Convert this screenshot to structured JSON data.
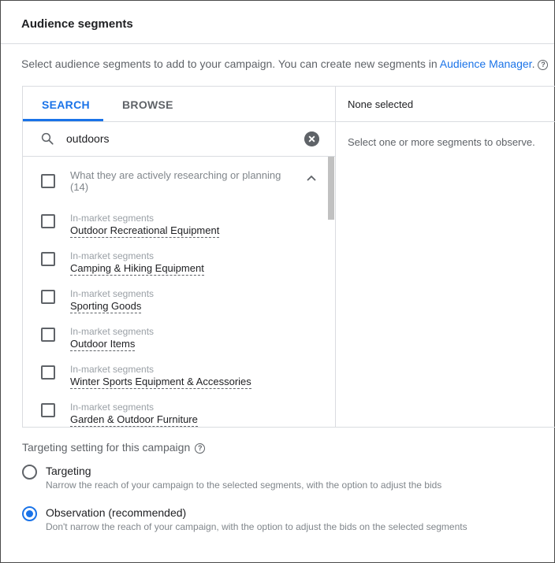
{
  "card": {
    "title": "Audience segments"
  },
  "description": {
    "text": "Select audience segments to add to your campaign. You can create new segments in ",
    "link": "Audience Manager",
    "suffix": "."
  },
  "tabs": [
    {
      "label": "SEARCH",
      "active": true
    },
    {
      "label": "BROWSE",
      "active": false
    }
  ],
  "search": {
    "value": "outdoors",
    "icon": "search-icon",
    "clear_icon": "clear-icon"
  },
  "group": {
    "label": "What they are actively researching or planning",
    "count": "(14)",
    "expanded": true
  },
  "items": [
    {
      "category": "In-market segments",
      "name": "Outdoor Recreational Equipment",
      "checked": false
    },
    {
      "category": "In-market segments",
      "name": "Camping & Hiking Equipment",
      "checked": false
    },
    {
      "category": "In-market segments",
      "name": "Sporting Goods",
      "checked": false
    },
    {
      "category": "In-market segments",
      "name": "Outdoor Items",
      "checked": false
    },
    {
      "category": "In-market segments",
      "name": "Winter Sports Equipment & Accessories",
      "checked": false
    },
    {
      "category": "In-market segments",
      "name": "Garden & Outdoor Furniture",
      "checked": false
    }
  ],
  "selected_panel": {
    "header": "None selected",
    "hint": "Select one or more segments to observe."
  },
  "targeting": {
    "title": "Targeting setting for this campaign",
    "options": [
      {
        "label": "Targeting",
        "description": "Narrow the reach of your campaign to the selected segments, with the option to adjust the bids",
        "selected": false
      },
      {
        "label": "Observation (recommended)",
        "description": "Don't narrow the reach of your campaign, with the option to adjust the bids on the selected segments",
        "selected": true
      }
    ]
  },
  "colors": {
    "accent": "#1a73e8",
    "text": "#202124",
    "muted": "#5f6368",
    "border": "#dadce0"
  }
}
